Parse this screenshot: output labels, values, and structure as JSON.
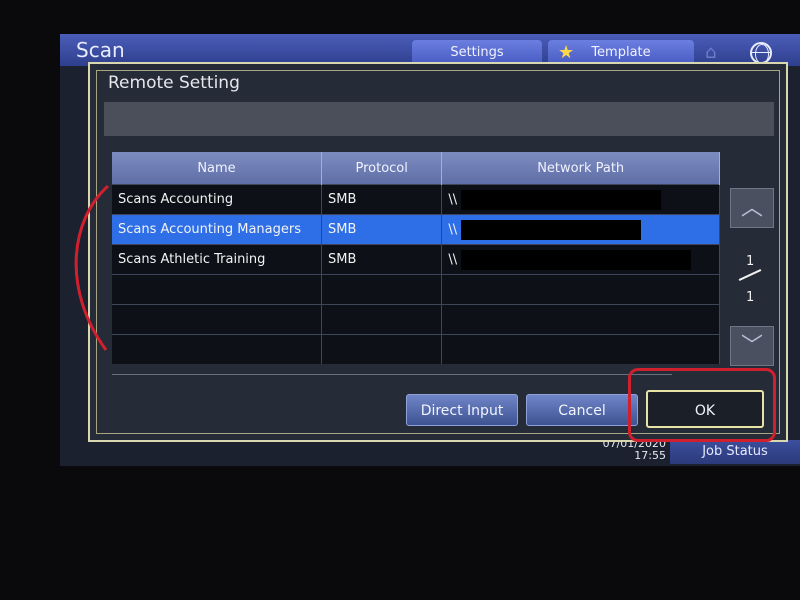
{
  "app": {
    "title": "Scan",
    "tabs": [
      {
        "label": "Settings"
      },
      {
        "label": "Template"
      }
    ],
    "datetime": {
      "date": "07/01/2020",
      "time": "17:55"
    },
    "job_status_label": "Job Status"
  },
  "dialog": {
    "title": "Remote Setting",
    "table": {
      "headers": [
        "Name",
        "Protocol",
        "Network Path"
      ],
      "rows": [
        {
          "name": "Scans Accounting",
          "protocol": "SMB",
          "path_prefix": "\\\\"
        },
        {
          "name": "Scans Accounting Managers",
          "protocol": "SMB",
          "path_prefix": "\\\\"
        },
        {
          "name": "Scans Athletic Training",
          "protocol": "SMB",
          "path_prefix": "\\\\"
        }
      ],
      "selected_row_index": 1
    },
    "pager": {
      "current": "1",
      "total": "1"
    },
    "buttons": {
      "direct_input": "Direct Input",
      "cancel": "Cancel",
      "ok": "OK"
    }
  },
  "icons": {
    "star": "star-icon",
    "home": "home-icon",
    "globe": "globe-icon",
    "up": "chevron-up-icon",
    "down": "chevron-down-icon"
  },
  "colors": {
    "accent": "#2e6fe8",
    "highlight_annotation": "#d0202e"
  }
}
